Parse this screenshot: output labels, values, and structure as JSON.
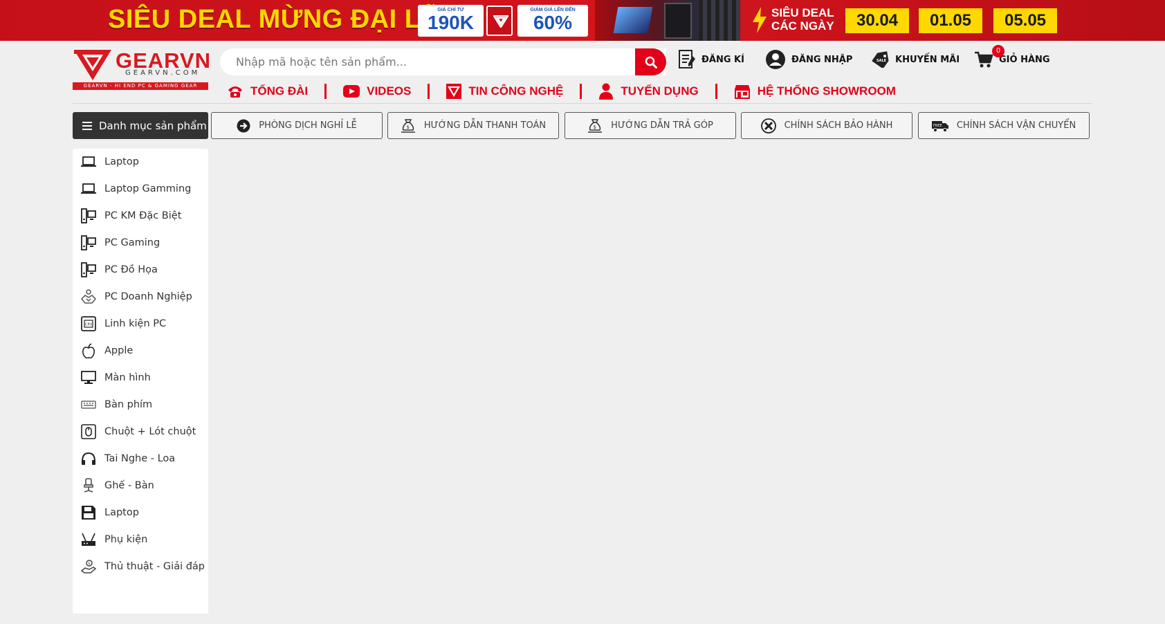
{
  "banner": {
    "headline": "SIÊU DEAL MỪNG ĐẠI LỄ",
    "price_caption": "GIÁ CHỈ TỪ",
    "price_value": "190K",
    "discount_caption": "GIẢM GIÁ LÊN ĐẾN",
    "discount_value": "60%",
    "daily_deal_line1": "SIÊU DEAL",
    "daily_deal_line2": "CÁC NGÀY",
    "dates": [
      "30.04",
      "01.05",
      "05.05"
    ]
  },
  "logo": {
    "name": "GEARVN",
    "domain": "GEARVN.COM",
    "tagline": "GEARVN - HI END PC & GAMING GEAR"
  },
  "search": {
    "placeholder": "Nhập mã hoặc tên sản phẩm..."
  },
  "account": {
    "register": "ĐĂNG KÍ",
    "login": "ĐĂNG NHẬP",
    "promotions": "KHUYẾN MÃI",
    "cart": "GIỎ HÀNG",
    "cart_count": "0"
  },
  "nav": {
    "items": [
      "TỔNG ĐÀI",
      "VIDEOS",
      "TIN CÔNG NGHỆ",
      "TUYỂN DỤNG",
      "HỆ THỐNG SHOWROOM"
    ]
  },
  "category_button": "Danh mục sản phẩm",
  "policies": [
    "PHÒNG DỊCH NGHỈ LỄ",
    "HƯỚNG DẪN THANH TOÁN",
    "HƯỚNG DẪN TRẢ GÓP",
    "CHÍNH SÁCH BẢO HÀNH",
    "CHÍNH SÁCH VẬN CHUYỂN"
  ],
  "sidebar": {
    "items": [
      {
        "label": "Laptop",
        "icon": "laptop-icon"
      },
      {
        "label": "Laptop Gamming",
        "icon": "laptop-icon"
      },
      {
        "label": "PC KM Đặc Biệt",
        "icon": "pc-icon"
      },
      {
        "label": "PC Gaming",
        "icon": "pc-icon"
      },
      {
        "label": "PC Đồ Họa",
        "icon": "pc-icon"
      },
      {
        "label": "PC Doanh Nghiệp",
        "icon": "handshake-icon"
      },
      {
        "label": "Linh kiện PC",
        "icon": "cpu-icon"
      },
      {
        "label": "Apple",
        "icon": "apple-icon"
      },
      {
        "label": "Màn hình",
        "icon": "monitor-icon"
      },
      {
        "label": "Bàn phím",
        "icon": "keyboard-icon"
      },
      {
        "label": "Chuột + Lót chuột",
        "icon": "mouse-icon"
      },
      {
        "label": "Tai Nghe - Loa",
        "icon": "headphones-icon"
      },
      {
        "label": "Ghế - Bàn",
        "icon": "chair-icon"
      },
      {
        "label": "Laptop",
        "icon": "floppy-icon"
      },
      {
        "label": "Phụ kiện",
        "icon": "router-icon"
      },
      {
        "label": "Thủ thuật - Giải đáp",
        "icon": "support-icon"
      }
    ]
  },
  "colors": {
    "brand_red": "#e30019",
    "banner_red": "#c5101a",
    "banner_yellow": "#ffd800",
    "dark_button": "#333333",
    "page_bg": "#efefef"
  }
}
